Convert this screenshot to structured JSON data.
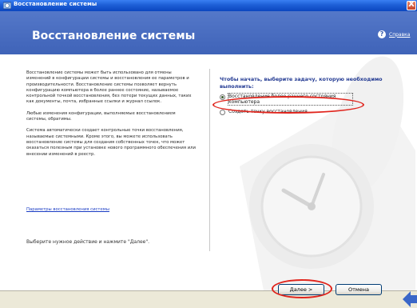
{
  "window": {
    "title": "Восстановление системы",
    "close_label": "X"
  },
  "header": {
    "title": "Восстановление системы",
    "help_label": "Справка"
  },
  "left": {
    "paragraphs": [
      "Восстановление системы может быть использовано для отмены изменений в конфигурации системы и восстановления ее параметров и производительности. Восстановление системы позволяет вернуть конфигурацию компьютера в более раннее состояние, называемое контрольной точкой восстановления, без потери текущих данных, таких как документы, почта, избранные ссылки и журнал ссылок.",
      "Любые изменения конфигурации, выполняемые восстановлением системы, обратимы.",
      "Система автоматически создает контрольные точки восстановления, называемые системными. Кроме этого, вы можете использовать восстановление системы для создания собственных точек, что может оказаться полезным при установке нового программного обеспечения или внесении изменений в реестр."
    ],
    "settings_link": "Параметры восстановления системы",
    "instruction": "Выберите нужное действие и нажмите \"Далее\"."
  },
  "right": {
    "heading": "Чтобы начать, выберите задачу, которую необходимо выполнить:",
    "options": [
      {
        "label": "Восстановление более раннего состояния компьютера",
        "selected": true
      },
      {
        "label": "Создать точку восстановления",
        "selected": false
      }
    ]
  },
  "buttons": {
    "next": "Далее >",
    "cancel": "Отмена"
  },
  "colors": {
    "titlebar": "#1d5fd6",
    "header": "#4a6fc2",
    "annotation": "#e0241c",
    "link": "#1a3cc4"
  }
}
